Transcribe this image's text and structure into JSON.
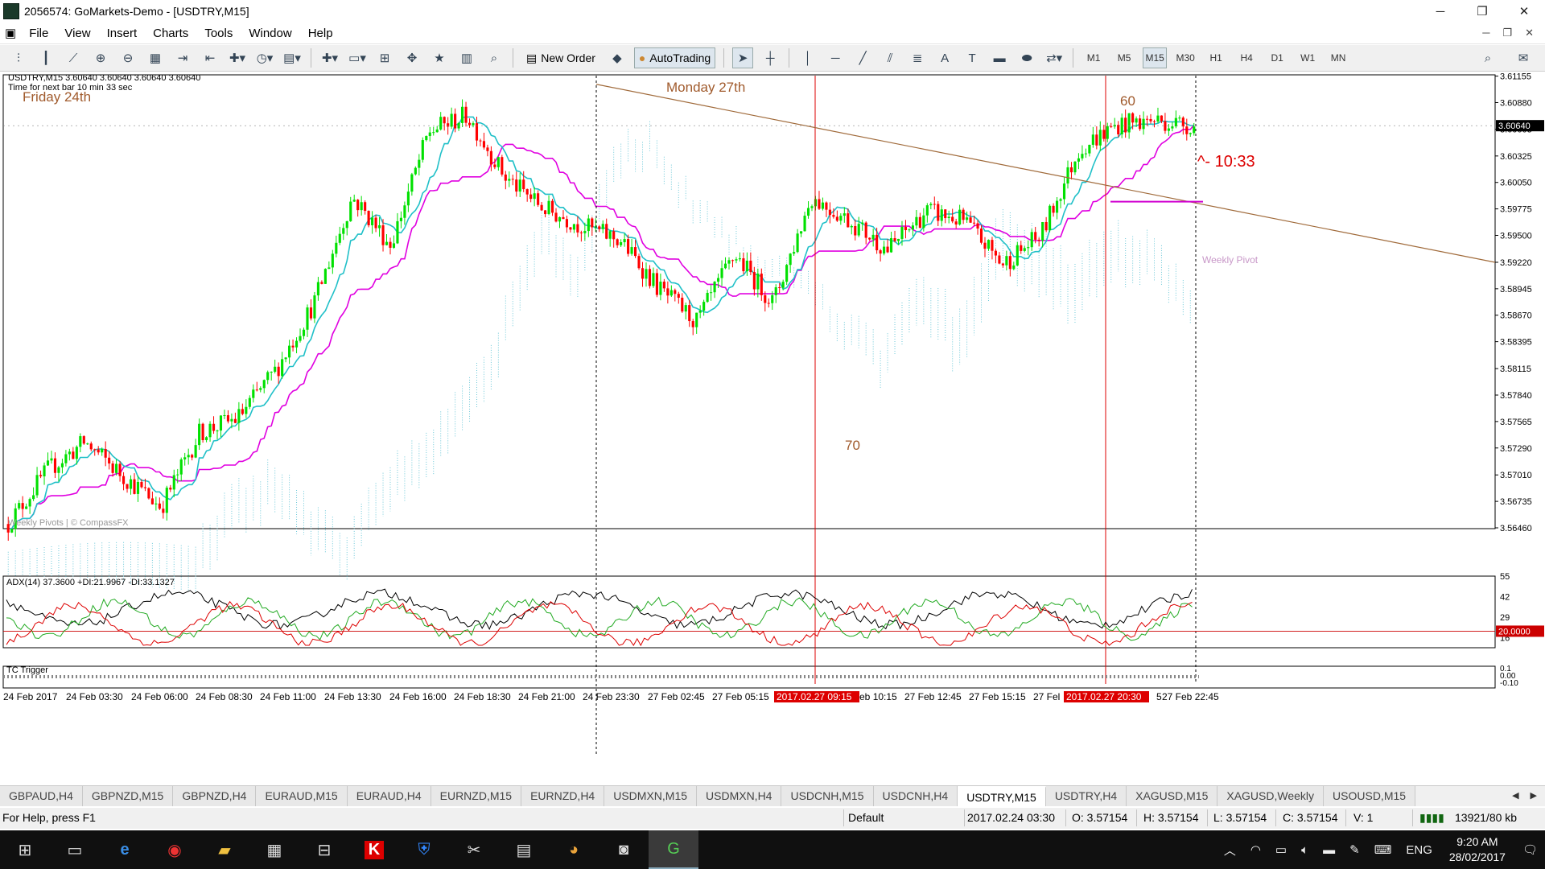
{
  "window": {
    "title": "2056574: GoMarkets-Demo - [USDTRY,M15]"
  },
  "menu": [
    "File",
    "View",
    "Insert",
    "Charts",
    "Tools",
    "Window",
    "Help"
  ],
  "toolbar": {
    "new_order": "New Order",
    "autotrading": "AutoTrading",
    "timeframes": [
      "M1",
      "M5",
      "M15",
      "M30",
      "H1",
      "H4",
      "D1",
      "W1",
      "MN"
    ],
    "active_timeframe": "M15"
  },
  "chart": {
    "symbol_line": "USDTRY,M15  3.60640 3.60640 3.60640 3.60640",
    "timer_text": "Time for next bar 10 min 33 sec",
    "friday_label": "Friday 24th",
    "monday_label": "Monday 27th",
    "annotation_60": "60",
    "annotation_70": "70",
    "timer_annotation": "^- 10:33",
    "weekly_pivot_label": "Weekly Pivot",
    "copyright": "Weekly Pivots | © CompassFX",
    "current_price": "3.60640",
    "price_ticks": [
      "3.61155",
      "3.60880",
      "3.60603",
      "3.60325",
      "3.60050",
      "3.59775",
      "3.59500",
      "3.59220",
      "3.58945",
      "3.58670",
      "3.58395",
      "3.58115",
      "3.57840",
      "3.57565",
      "3.57290",
      "3.57010",
      "3.56735",
      "3.56460"
    ],
    "adx_label": "ADX(14) 37.3600 +DI:21.9967 -DI:33.1327",
    "adx_ticks": [
      "55",
      "42",
      "29",
      "16"
    ],
    "adx_level": "20.0000",
    "tc_label": "TC Trigger",
    "tc_ticks": [
      "0.1",
      "0.00",
      "-0.10"
    ],
    "time_labels": [
      "24 Feb 2017",
      "24 Feb 03:30",
      "24 Feb 06:00",
      "24 Feb 08:30",
      "24 Feb 11:00",
      "24 Feb 13:30",
      "24 Feb 16:00",
      "24 Feb 18:30",
      "24 Feb 21:00",
      "24 Feb 23:30",
      "27 Feb 02:45",
      "27 Feb 05:15",
      "27 Feb 10:15",
      "27 Feb 12:45",
      "27 Feb 15:15",
      "27 Fel",
      "5",
      "27 Feb 22:45"
    ],
    "highlight_times": [
      "2017.02.27 09:15",
      "2017.02.27 20:30"
    ]
  },
  "chart_data": {
    "type": "candlestick",
    "symbol": "USDTRY",
    "timeframe": "M15",
    "ylim": [
      3.5646,
      3.6116
    ],
    "close_last": 3.6064,
    "trendline_start": 3.6107,
    "trendline_end": 3.5922,
    "weekly_pivot": 3.5985,
    "adx": 37.36,
    "plus_di": 21.9967,
    "minus_di": 33.1327,
    "adx_level": 20,
    "trend_anchors": [
      3.565,
      3.5705,
      3.5735,
      3.57,
      3.5668,
      3.5745,
      3.576,
      3.581,
      3.588,
      3.599,
      3.594,
      3.6058,
      3.6075,
      3.601,
      3.5978,
      3.596,
      3.5945,
      3.5895,
      3.586,
      3.593,
      3.588,
      3.599,
      3.5965,
      3.5935,
      3.5975,
      3.5965,
      3.592,
      3.595,
      3.604,
      3.6065,
      3.607,
      3.6064
    ],
    "bullish_color": "#00e000",
    "bearish_color": "#ff0000",
    "kijun_color": "#e000e0",
    "tenkan_color": "#20c0c8"
  },
  "tabs": [
    "GBPAUD,H4",
    "GBPNZD,M15",
    "GBPNZD,H4",
    "EURAUD,M15",
    "EURAUD,H4",
    "EURNZD,M15",
    "EURNZD,H4",
    "USDMXN,M15",
    "USDMXN,H4",
    "USDCNH,M15",
    "USDCNH,H4",
    "USDTRY,M15",
    "USDTRY,H4",
    "XAGUSD,M15",
    "XAGUSD,Weekly",
    "USOUSD,M15"
  ],
  "active_tab": "USDTRY,M15",
  "status": {
    "help": "For Help, press F1",
    "profile": "Default",
    "datetime": "2017.02.24 03:30",
    "open": "O: 3.57154",
    "high": "H: 3.57154",
    "low": "L: 3.57154",
    "close": "C: 3.57154",
    "volume": "V: 1",
    "traffic": "13921/80 kb"
  },
  "taskbar": {
    "language": "ENG",
    "time": "9:20 AM",
    "date": "28/02/2017"
  }
}
